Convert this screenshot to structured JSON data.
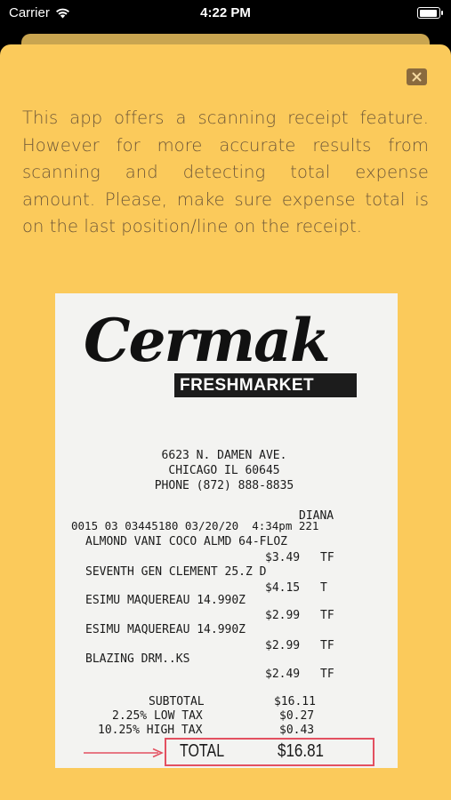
{
  "status_bar": {
    "carrier": "Carrier",
    "time": "4:22 PM",
    "battery_level": 1.0
  },
  "info": {
    "text": "This app offers a scanning receipt feature. However for more accurate results from scanning and detecting total expense amount. Please, make sure expense total is on the last position/line on the receipt."
  },
  "receipt": {
    "logo_word": "Cermak",
    "logo_sub": "FRESHMARKET",
    "address": [
      "6623 N. DAMEN AVE.",
      "CHICAGO IL 60645",
      "PHONE (872) 888-8835"
    ],
    "cashier": "DIANA",
    "transaction": "0015 03 03445180 03/20/20  4:34pm 221",
    "items": [
      {
        "name": "ALMOND VANI COCO ALMD 64-FLOZ",
        "price": "$3.49",
        "code": "TF"
      },
      {
        "name": "SEVENTH GEN CLEMENT 25.Z D",
        "price": "$4.15",
        "code": "T"
      },
      {
        "name": "ESIMU MAQUEREAU 14.990Z",
        "price": "$2.99",
        "code": "TF"
      },
      {
        "name": "ESIMU MAQUEREAU 14.990Z",
        "price": "$2.99",
        "code": "TF"
      },
      {
        "name": "BLAZING DRM..KS",
        "price": "$2.49",
        "code": "TF"
      }
    ],
    "subtotal_label": "SUBTOTAL",
    "subtotal_value": "$16.11",
    "low_tax_label": "2.25% LOW TAX",
    "low_tax_value": "$0.27",
    "high_tax_label": "10.25% HIGH TAX",
    "high_tax_value": "$0.43",
    "total_label": "TOTAL",
    "total_value": "$16.81"
  },
  "colors": {
    "sheet": "#fbca5b",
    "text": "#6e5738",
    "highlight": "#e35060"
  }
}
